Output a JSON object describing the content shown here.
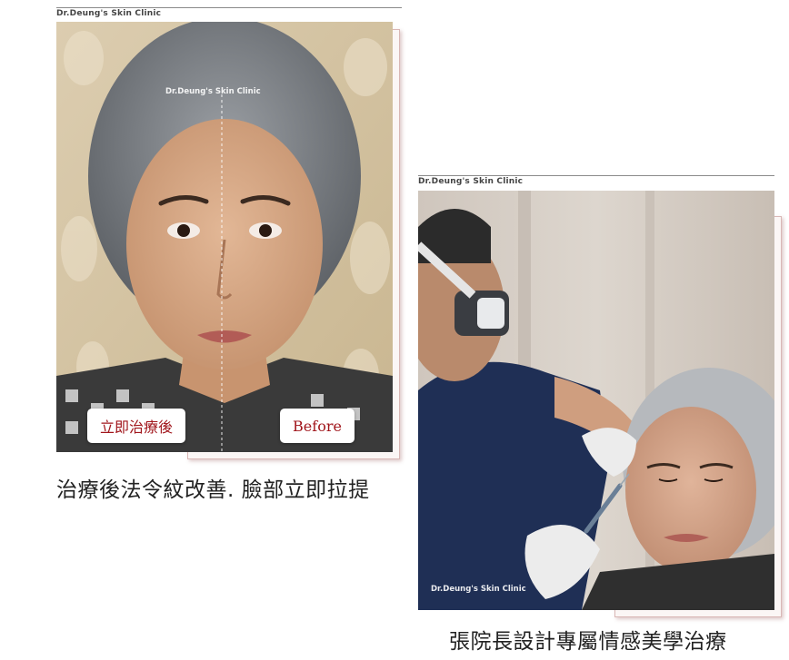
{
  "left_card": {
    "brand": "Dr.Deung's Skin Clinic",
    "watermark": "Dr.Deung's Skin Clinic",
    "label_after": "立即治療後",
    "label_before": "Before",
    "caption": "治療後法令紋改善. 臉部立即拉提"
  },
  "right_card": {
    "brand": "Dr.Deung's Skin Clinic",
    "watermark": "Dr.Deung's Skin Clinic",
    "caption": "張院長設計專屬情感美學治療"
  }
}
